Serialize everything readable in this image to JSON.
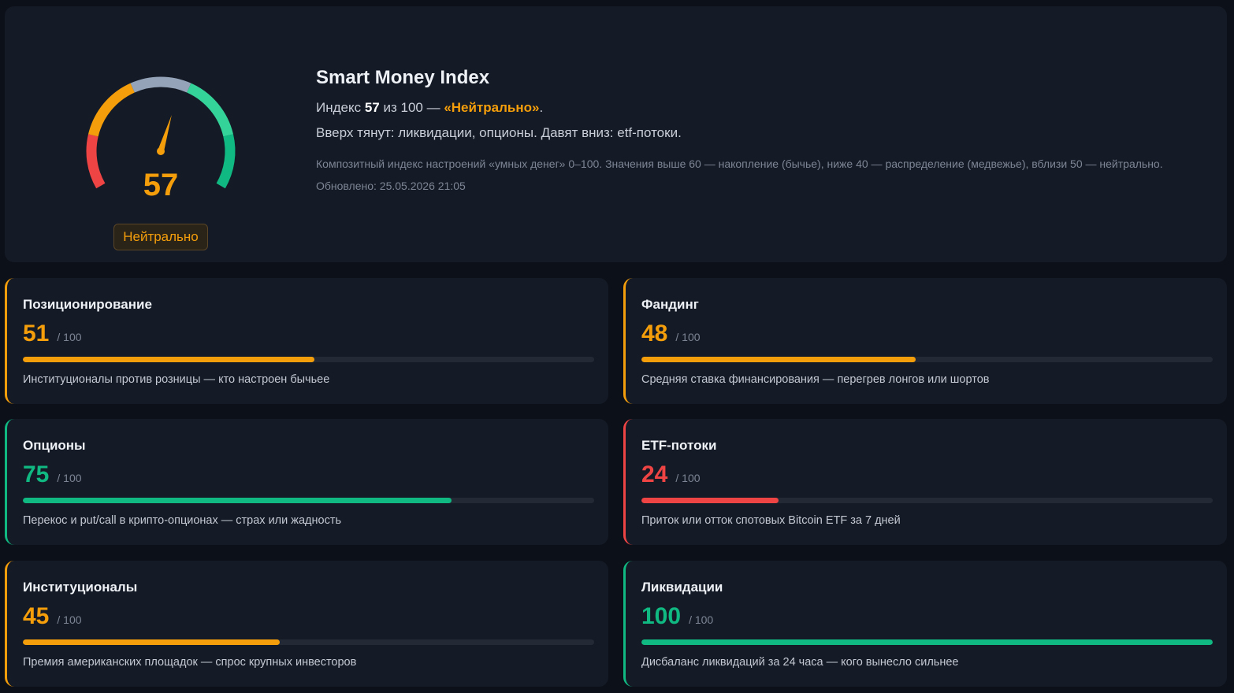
{
  "colors": {
    "neutral": "#f59e0b",
    "bullish": "#10b981",
    "bearish": "#ef4444",
    "gauge_neutral_segment": "#94a3b8"
  },
  "gauge": {
    "value": 57,
    "value_text": "57",
    "badge": "Нейтрально",
    "color": "#f59e0b"
  },
  "info": {
    "title": "Smart Money Index",
    "line1_prefix": "Индекс ",
    "line1_value": "57",
    "line1_mid": " из 100 — ",
    "line1_mood": "«Нейтрально»",
    "line1_suffix": ".",
    "line2": "Вверх тянут: ликвидации, опционы. Давят вниз: etf-потоки.",
    "description": "Композитный индекс настроений «умных денег» 0–100. Значения выше 60 — накопление (бычье), ниже 40 — распределение (медвежье), вблизи 50 — нейтрально.",
    "updated": "Обновлено: 25.05.2026 21:05"
  },
  "cards": [
    {
      "title": "Позиционирование",
      "score": 51,
      "score_text": "51",
      "max": "/ 100",
      "color": "#f59e0b",
      "desc": "Институционалы против розницы — кто настроен бычьее"
    },
    {
      "title": "Фандинг",
      "score": 48,
      "score_text": "48",
      "max": "/ 100",
      "color": "#f59e0b",
      "desc": "Средняя ставка финансирования — перегрев лонгов или шортов"
    },
    {
      "title": "Опционы",
      "score": 75,
      "score_text": "75",
      "max": "/ 100",
      "color": "#10b981",
      "desc": "Перекос и put/call в крипто-опционах — страх или жадность"
    },
    {
      "title": "ETF-потоки",
      "score": 24,
      "score_text": "24",
      "max": "/ 100",
      "color": "#ef4444",
      "desc": "Приток или отток спотовых Bitcoin ETF за 7 дней"
    },
    {
      "title": "Институционалы",
      "score": 45,
      "score_text": "45",
      "max": "/ 100",
      "color": "#f59e0b",
      "desc": "Премия американских площадок — спрос крупных инвесторов"
    },
    {
      "title": "Ликвидации",
      "score": 100,
      "score_text": "100",
      "max": "/ 100",
      "color": "#10b981",
      "desc": "Дисбаланс ликвидаций за 24 часа — кого вынесло сильнее"
    }
  ]
}
